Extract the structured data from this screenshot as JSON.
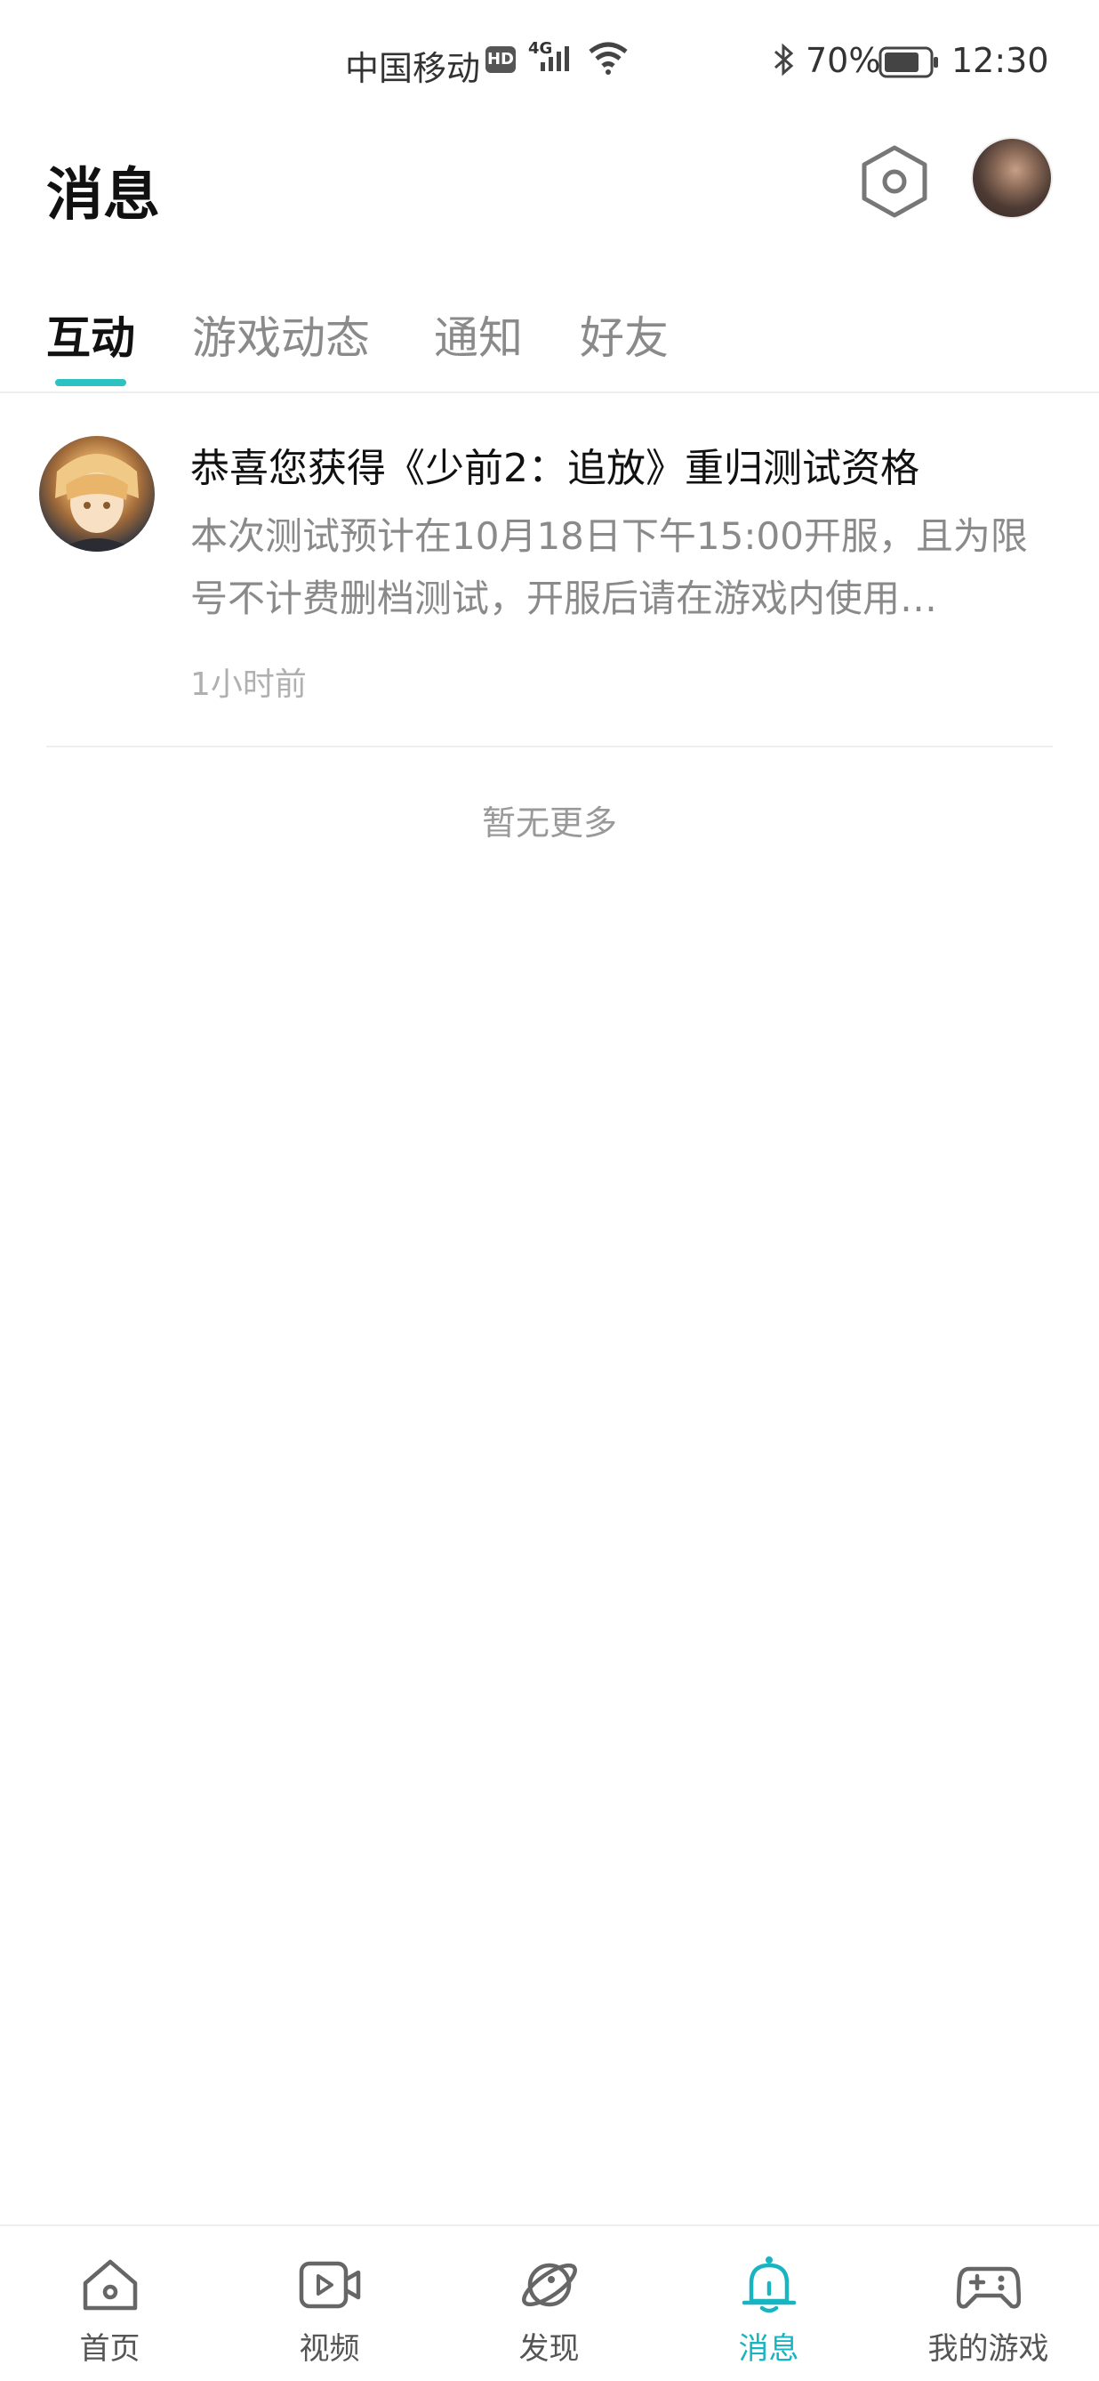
{
  "status_bar": {
    "carrier": "中国移动",
    "hd": "HD",
    "network": "4G",
    "battery_pct": "70%",
    "time": "12:30"
  },
  "header": {
    "title": "消息"
  },
  "tabs": [
    {
      "label": "互动",
      "active": true
    },
    {
      "label": "游戏动态",
      "active": false
    },
    {
      "label": "通知",
      "active": false
    },
    {
      "label": "好友",
      "active": false
    }
  ],
  "messages": [
    {
      "title": "恭喜您获得《少前2：追放》重归测试资格",
      "body": "本次测试预计在10月18日下午15:00开服，且为限号不计费删档测试，开服后请在游戏内使用…",
      "time": "1小时前"
    }
  ],
  "list_end_text": "暂无更多",
  "bottom_nav": [
    {
      "label": "首页",
      "icon": "home-icon"
    },
    {
      "label": "视频",
      "icon": "video-icon"
    },
    {
      "label": "发现",
      "icon": "planet-icon"
    },
    {
      "label": "消息",
      "icon": "bell-icon",
      "active": true
    },
    {
      "label": "我的游戏",
      "icon": "gamepad-icon"
    }
  ],
  "colors": {
    "accent": "#2cc2c2",
    "active_nav": "#19b4c2"
  }
}
